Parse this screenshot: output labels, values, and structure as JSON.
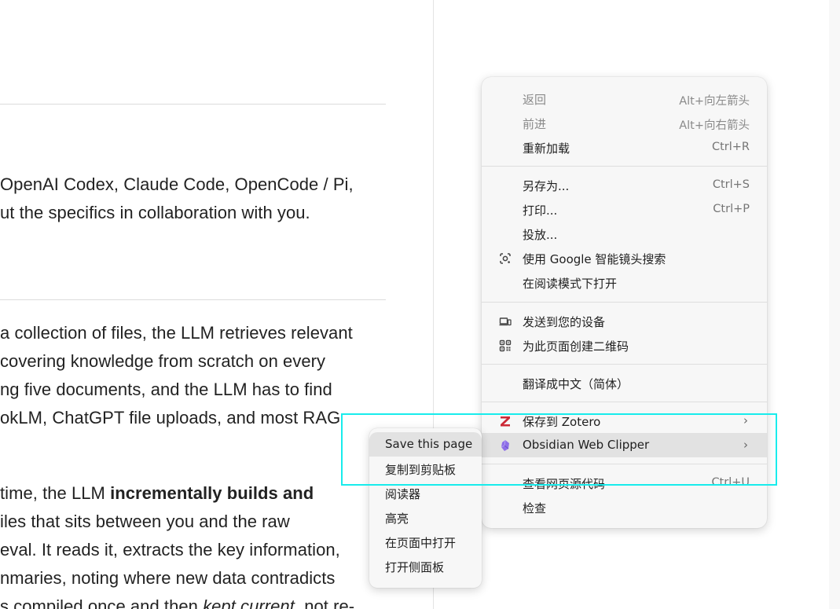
{
  "article": {
    "lines": [
      {
        "segments": [
          {
            "t": "OpenAI Codex, Claude Code, OpenCode / Pi,",
            "s": "n"
          }
        ]
      },
      {
        "segments": [
          {
            "t": "ut the specifics in collaboration with you.",
            "s": "n"
          }
        ]
      },
      {
        "segments": [
          {
            "t": "a collection of files, the LLM retrieves relevant",
            "s": "n"
          }
        ]
      },
      {
        "segments": [
          {
            "t": "covering knowledge from scratch on every",
            "s": "n"
          }
        ]
      },
      {
        "segments": [
          {
            "t": "ng five documents, and the LLM has to find",
            "s": "n"
          }
        ]
      },
      {
        "segments": [
          {
            "t": "okLM, ChatGPT file uploads, and most RAG",
            "s": "n"
          }
        ]
      },
      {
        "segments": [
          {
            "t": "time, the LLM ",
            "s": "n"
          },
          {
            "t": "incrementally builds and",
            "s": "b"
          }
        ]
      },
      {
        "segments": [
          {
            "t": "iles that sits between you and the raw",
            "s": "n"
          }
        ]
      },
      {
        "segments": [
          {
            "t": "eval. It reads it, extracts the key information,",
            "s": "n"
          }
        ]
      },
      {
        "segments": [
          {
            "t": "nmaries, noting where new data contradicts",
            "s": "n"
          }
        ]
      },
      {
        "segments": [
          {
            "t": "s compiled once and then ",
            "s": "n"
          },
          {
            "t": "kept current",
            "s": "i"
          },
          {
            "t": ", not re-",
            "s": "n"
          }
        ]
      }
    ]
  },
  "context_menu": {
    "items": [
      {
        "label": "返回",
        "shortcut": "Alt+向左箭头",
        "disabled": true,
        "icon": ""
      },
      {
        "label": "前进",
        "shortcut": "Alt+向右箭头",
        "disabled": true,
        "icon": ""
      },
      {
        "label": "重新加载",
        "shortcut": "Ctrl+R",
        "disabled": false,
        "icon": ""
      },
      {
        "label": "另存为...",
        "shortcut": "Ctrl+S",
        "disabled": false,
        "icon": ""
      },
      {
        "label": "打印...",
        "shortcut": "Ctrl+P",
        "disabled": false,
        "icon": ""
      },
      {
        "label": "投放...",
        "shortcut": "",
        "disabled": false,
        "icon": ""
      },
      {
        "label": "使用 Google 智能镜头搜索",
        "shortcut": "",
        "disabled": false,
        "icon": "google-lens-icon"
      },
      {
        "label": "在阅读模式下打开",
        "shortcut": "",
        "disabled": false,
        "icon": ""
      },
      {
        "label": "发送到您的设备",
        "shortcut": "",
        "disabled": false,
        "icon": "send-to-device-icon"
      },
      {
        "label": "为此页面创建二维码",
        "shortcut": "",
        "disabled": false,
        "icon": "qr-code-icon"
      },
      {
        "label": "翻译成中文（简体）",
        "shortcut": "",
        "disabled": false,
        "icon": ""
      },
      {
        "label": "保存到 Zotero",
        "shortcut": "",
        "disabled": false,
        "icon": "zotero-icon",
        "submenu": true
      },
      {
        "label": "Obsidian Web Clipper",
        "shortcut": "",
        "disabled": false,
        "icon": "obsidian-icon",
        "submenu": true,
        "highlighted": true
      },
      {
        "label": "查看网页源代码",
        "shortcut": "Ctrl+U",
        "disabled": false,
        "icon": ""
      },
      {
        "label": "检查",
        "shortcut": "",
        "disabled": false,
        "icon": ""
      }
    ]
  },
  "submenu": {
    "items": [
      {
        "label": "Save this page",
        "highlighted": true
      },
      {
        "label": "复制到剪贴板"
      },
      {
        "label": "阅读器"
      },
      {
        "label": "高亮"
      },
      {
        "label": "在页面中打开"
      },
      {
        "label": "打开侧面板"
      }
    ]
  },
  "colors": {
    "annotation_box": "#18ecec",
    "menu_bg": "#f7f7f7",
    "highlight_bg": "#e2e2e2",
    "zotero_red": "#cc2936",
    "obsidian_purple": "#8e6fe8"
  }
}
